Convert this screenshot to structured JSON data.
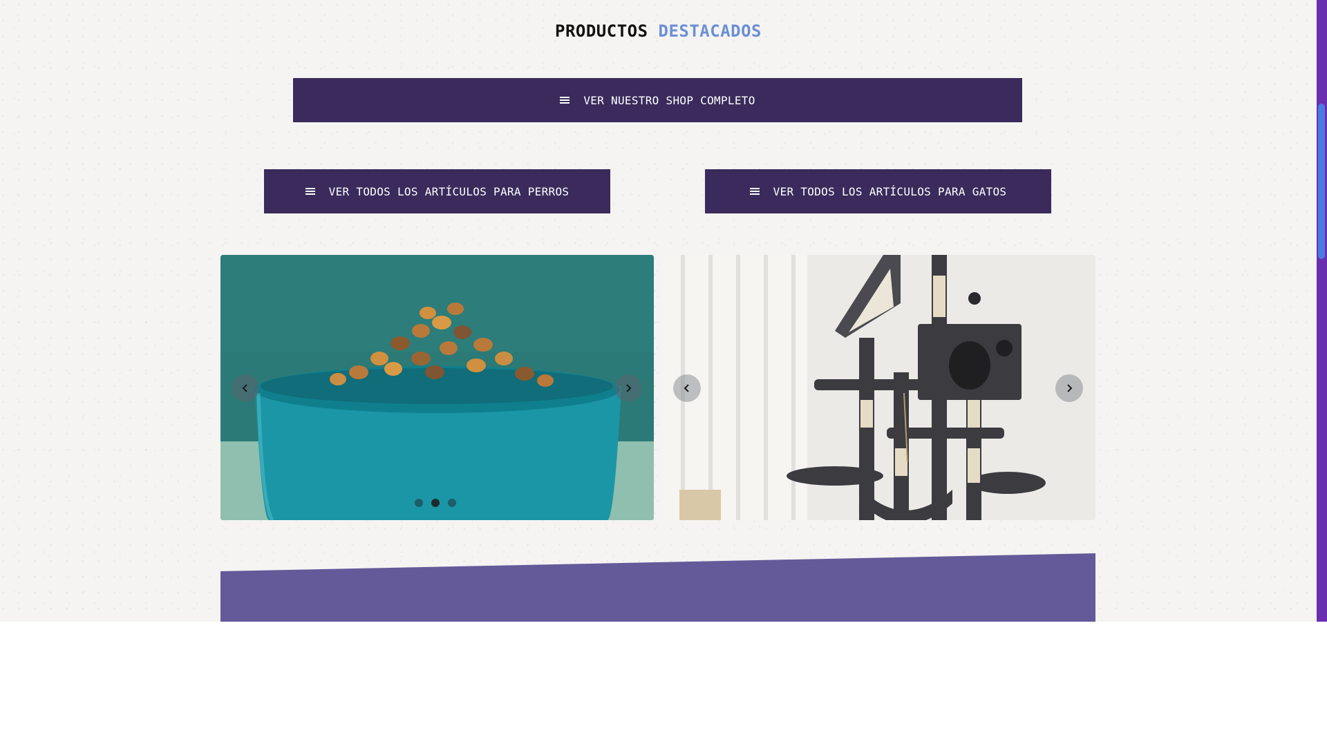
{
  "section": {
    "title_part1": "PRODUCTOS",
    "title_part2": "DESTACADOS",
    "accent_color": "#6b8fd6"
  },
  "buttons": {
    "shop_label": "VER NUESTRO SHOP COMPLETO",
    "dogs_label": "VER TODOS LOS ARTÍCULOS PARA PERROS",
    "cats_label": "VER TODOS LOS ARTÍCULOS PARA GATOS",
    "icon": "menu-icon",
    "color": "#3a2b5c"
  },
  "carousels": [
    {
      "image": "dog-food-bowl",
      "prev_icon": "chevron-left-icon",
      "next_icon": "chevron-right-icon",
      "slide_count": 3,
      "active_slide": 2
    },
    {
      "image": "cat-tree",
      "prev_icon": "chevron-left-icon",
      "next_icon": "chevron-right-icon"
    }
  ],
  "colors": {
    "band": "#645a9a",
    "scrollbar_track": "#6a2fb0",
    "scrollbar_thumb": "#4a7be0"
  }
}
